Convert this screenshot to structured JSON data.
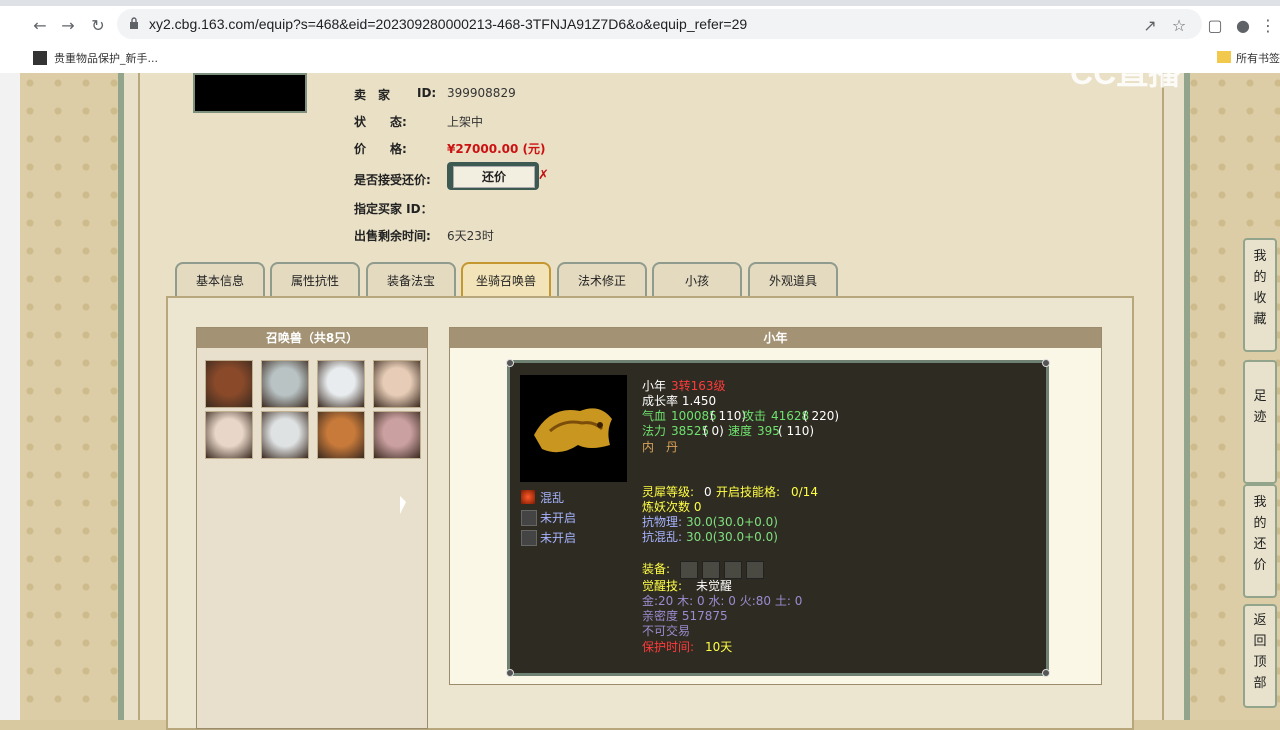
{
  "browser": {
    "url": "xy2.cbg.163.com/equip?s=468&eid=202309280000213-468-3TFNJA91Z7D6&o&equip_refer=29",
    "bookmark_left": "贵重物品保护_新手...",
    "bookmark_right": "所有书签"
  },
  "watermark": "CC直播",
  "seller": {
    "seller_label": "卖　家",
    "id_label": "ID:",
    "id_value": "399908829",
    "status_label": "状　　态:",
    "status_value": "上架中",
    "price_label": "价　　格:",
    "price_value": "¥27000.00 (元)",
    "haggle_label": "是否接受还价:",
    "haggle_button": "还价",
    "buyer_label": "指定买家 ID：",
    "remaining_label": "出售剩余时间:",
    "remaining_value": "6天23时"
  },
  "tabs": [
    {
      "label": "基本信息"
    },
    {
      "label": "属性抗性"
    },
    {
      "label": "装备法宝"
    },
    {
      "label": "坐骑召唤兽"
    },
    {
      "label": "法术修正"
    },
    {
      "label": "小孩"
    },
    {
      "label": "外观道具"
    }
  ],
  "pets_panel": {
    "title": "召唤兽（共8只）"
  },
  "pet_colors": [
    "#8a4a2a",
    "#b9c3c4",
    "#e8ecee",
    "#e7cdb7",
    "#e8d7c8",
    "#dfe2e3",
    "#c87a3a",
    "#caa0a0"
  ],
  "detail": {
    "title": "小年",
    "name": "小年",
    "level": "3转163级",
    "growth": "成长率 1.450",
    "hp_label": "气血",
    "hp_value": "100085",
    "hp_extra": "( 110)",
    "atk_label": "攻击",
    "atk_value": "41628",
    "atk_extra": "( 220)",
    "mp_label": "法力",
    "mp_value": "38525",
    "mp_extra": "( 0)",
    "spd_label": "速度",
    "spd_value": "395",
    "spd_extra": "( 110)",
    "neidan": "内　丹",
    "skills": [
      "混乱",
      "未开启",
      "未开启"
    ],
    "lingxi_label": "灵犀等级:",
    "lingxi_value": "0",
    "skill_slots_label": "开启技能格:",
    "skill_slots_value": "0/14",
    "lianyao": "炼妖次数 0",
    "phys_res_label": "抗物理:",
    "phys_res_value": "30.0(30.0+0.0)",
    "chaos_res_label": "抗混乱:",
    "chaos_res_value": "30.0(30.0+0.0)",
    "equip_label": "装备:",
    "awaken_label": "觉醒技:",
    "awaken_value": "未觉醒",
    "elements": "金:20 木: 0 水: 0 火:80 土: 0",
    "intimacy": "亲密度 517875",
    "trade": "不可交易",
    "protect_label": "保护时间:",
    "protect_value": "10天"
  },
  "side_buttons": [
    {
      "chars": [
        "我",
        "的",
        "收",
        "藏"
      ]
    },
    {
      "chars": [
        "足",
        "迹"
      ]
    },
    {
      "chars": [
        "我",
        "的",
        "还",
        "价"
      ]
    },
    {
      "chars": [
        "返",
        "回",
        "顶",
        "部"
      ]
    }
  ]
}
